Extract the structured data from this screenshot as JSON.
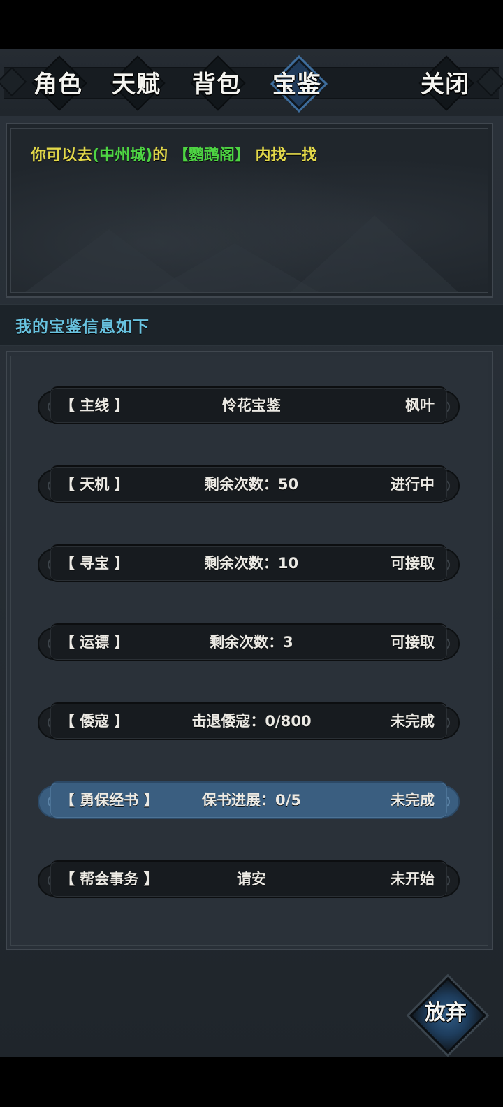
{
  "nav": {
    "tabs": [
      {
        "label": "角色",
        "active": false
      },
      {
        "label": "天赋",
        "active": false
      },
      {
        "label": "背包",
        "active": false
      },
      {
        "label": "宝鉴",
        "active": true
      }
    ],
    "close_label": "关闭"
  },
  "hint": {
    "part1": "你可以去",
    "city": "(中州城)",
    "part2": "的",
    "place": "【鹦鹉阁】",
    "part3": "内找一找"
  },
  "section": {
    "title": "我的宝鉴信息如下"
  },
  "entries": [
    {
      "category": "【 主线 】",
      "info": "怜花宝鉴",
      "status": "枫叶",
      "highlighted": false
    },
    {
      "category": "【 天机 】",
      "info": "剩余次数：50",
      "status": "进行中",
      "highlighted": false
    },
    {
      "category": "【 寻宝 】",
      "info": "剩余次数：10",
      "status": "可接取",
      "highlighted": false
    },
    {
      "category": "【 运镖 】",
      "info": "剩余次数：3",
      "status": "可接取",
      "highlighted": false
    },
    {
      "category": "【 倭寇 】",
      "info": "击退倭寇：0/800",
      "status": "未完成",
      "highlighted": false
    },
    {
      "category": "【 勇保经书 】",
      "info": "保书进展：0/5",
      "status": "未完成",
      "highlighted": true
    },
    {
      "category": "【 帮会事务 】",
      "info": "请安",
      "status": "未开始",
      "highlighted": false
    }
  ],
  "giveup_label": "放弃",
  "colors": {
    "hint_yellow": "#e2d84a",
    "hint_green": "#4ed443",
    "section_title": "#68c2df",
    "highlight_row": "#3a5e80"
  }
}
